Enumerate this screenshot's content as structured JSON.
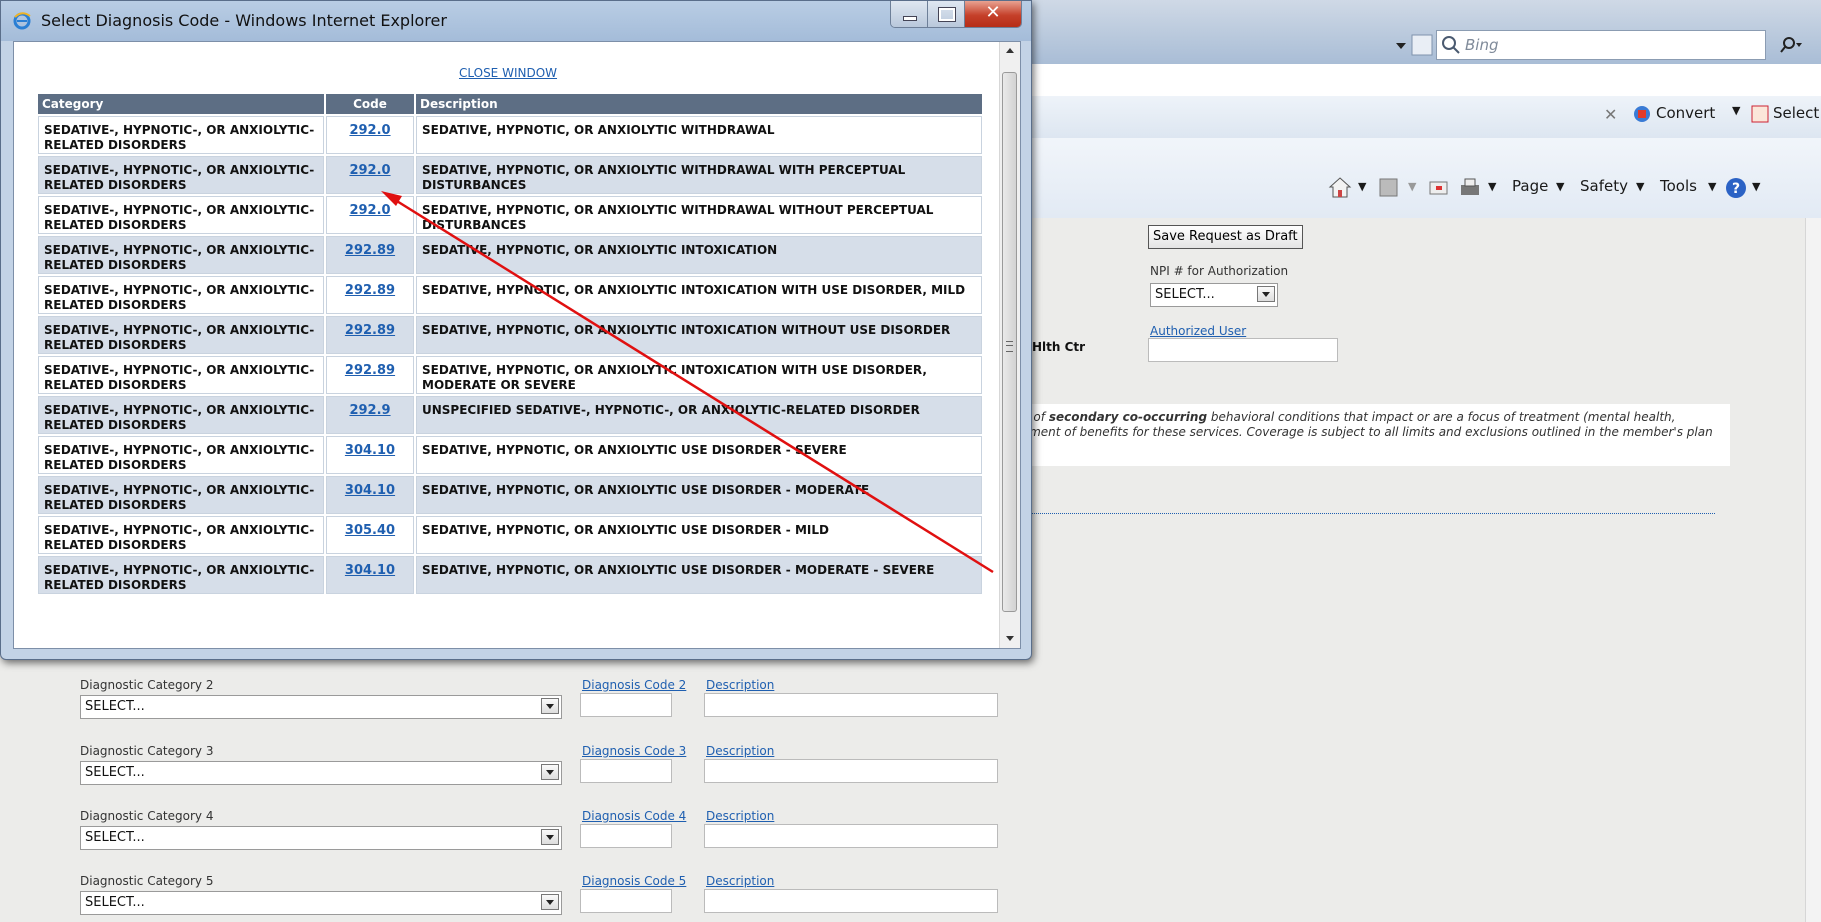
{
  "popup": {
    "title": "Select Diagnosis Code - Windows Internet Explorer",
    "close_link": "CLOSE WINDOW",
    "columns": [
      "Category",
      "Code",
      "Description"
    ],
    "rows": [
      {
        "category": "SEDATIVE-, HYPNOTIC-, OR ANXIOLYTIC-RELATED DISORDERS",
        "code": "292.0",
        "description": "SEDATIVE, HYPNOTIC, OR ANXIOLYTIC WITHDRAWAL"
      },
      {
        "category": "SEDATIVE-, HYPNOTIC-, OR ANXIOLYTIC-RELATED DISORDERS",
        "code": "292.0",
        "description": "SEDATIVE, HYPNOTIC, OR ANXIOLYTIC WITHDRAWAL WITH PERCEPTUAL DISTURBANCES"
      },
      {
        "category": "SEDATIVE-, HYPNOTIC-, OR ANXIOLYTIC-RELATED DISORDERS",
        "code": "292.0",
        "description": "SEDATIVE, HYPNOTIC, OR ANXIOLYTIC WITHDRAWAL WITHOUT PERCEPTUAL DISTURBANCES"
      },
      {
        "category": "SEDATIVE-, HYPNOTIC-, OR ANXIOLYTIC-RELATED DISORDERS",
        "code": "292.89",
        "description": "SEDATIVE, HYPNOTIC, OR ANXIOLYTIC INTOXICATION"
      },
      {
        "category": "SEDATIVE-, HYPNOTIC-, OR ANXIOLYTIC-RELATED DISORDERS",
        "code": "292.89",
        "description": "SEDATIVE, HYPNOTIC, OR ANXIOLYTIC INTOXICATION WITH USE DISORDER, MILD"
      },
      {
        "category": "SEDATIVE-, HYPNOTIC-, OR ANXIOLYTIC-RELATED DISORDERS",
        "code": "292.89",
        "description": "SEDATIVE, HYPNOTIC, OR ANXIOLYTIC INTOXICATION WITHOUT USE DISORDER"
      },
      {
        "category": "SEDATIVE-, HYPNOTIC-, OR ANXIOLYTIC-RELATED DISORDERS",
        "code": "292.89",
        "description": "SEDATIVE, HYPNOTIC, OR ANXIOLYTIC INTOXICATION WITH USE DISORDER, MODERATE OR SEVERE"
      },
      {
        "category": "SEDATIVE-, HYPNOTIC-, OR ANXIOLYTIC-RELATED DISORDERS",
        "code": "292.9",
        "description": "UNSPECIFIED SEDATIVE-, HYPNOTIC-, OR ANXIOLYTIC-RELATED DISORDER"
      },
      {
        "category": "SEDATIVE-, HYPNOTIC-, OR ANXIOLYTIC-RELATED DISORDERS",
        "code": "304.10",
        "description": "SEDATIVE, HYPNOTIC, OR ANXIOLYTIC USE DISORDER - SEVERE"
      },
      {
        "category": "SEDATIVE-, HYPNOTIC-, OR ANXIOLYTIC-RELATED DISORDERS",
        "code": "304.10",
        "description": "SEDATIVE, HYPNOTIC, OR ANXIOLYTIC USE DISORDER - MODERATE"
      },
      {
        "category": "SEDATIVE-, HYPNOTIC-, OR ANXIOLYTIC-RELATED DISORDERS",
        "code": "305.40",
        "description": "SEDATIVE, HYPNOTIC, OR ANXIOLYTIC USE DISORDER - MILD"
      },
      {
        "category": "SEDATIVE-, HYPNOTIC-, OR ANXIOLYTIC-RELATED DISORDERS",
        "code": "304.10",
        "description": "SEDATIVE, HYPNOTIC, OR ANXIOLYTIC USE DISORDER - MODERATE - SEVERE"
      }
    ]
  },
  "browser": {
    "search_placeholder": "Bing",
    "convert_label": "Convert",
    "select_label": "Select",
    "page_menu": "Page",
    "safety_menu": "Safety",
    "tools_menu": "Tools"
  },
  "form": {
    "save_draft": "Save Request as Draft",
    "npi_label": "NPI # for Authorization",
    "npi_select": "SELECT...",
    "authorized_user": "Authorized User",
    "facility_fragment": "Hlth Ctr",
    "notice_line1_pre": "n of ",
    "notice_line1_bold": "secondary co-occurring",
    "notice_line1_post": " behavioral conditions that impact or are a focus of treatment (mental health,",
    "notice_line2": "yment of benefits for these services. Coverage is subject to all limits and exclusions outlined in the member's plan",
    "diag_rows": [
      {
        "category_label": "Diagnostic Category 2",
        "select": "SELECT...",
        "code_label": "Diagnosis Code 2",
        "desc_label": "Description"
      },
      {
        "category_label": "Diagnostic Category 3",
        "select": "SELECT...",
        "code_label": "Diagnosis Code 3",
        "desc_label": "Description"
      },
      {
        "category_label": "Diagnostic Category 4",
        "select": "SELECT...",
        "code_label": "Diagnosis Code 4",
        "desc_label": "Description"
      },
      {
        "category_label": "Diagnostic Category 5",
        "select": "SELECT...",
        "code_label": "Diagnosis Code 5",
        "desc_label": "Description"
      }
    ]
  },
  "colors": {
    "header_bg": "#5d6e84",
    "alt_row_bg": "#d6dee9",
    "link": "#1f5fb0",
    "annotation_arrow": "#e01010"
  }
}
